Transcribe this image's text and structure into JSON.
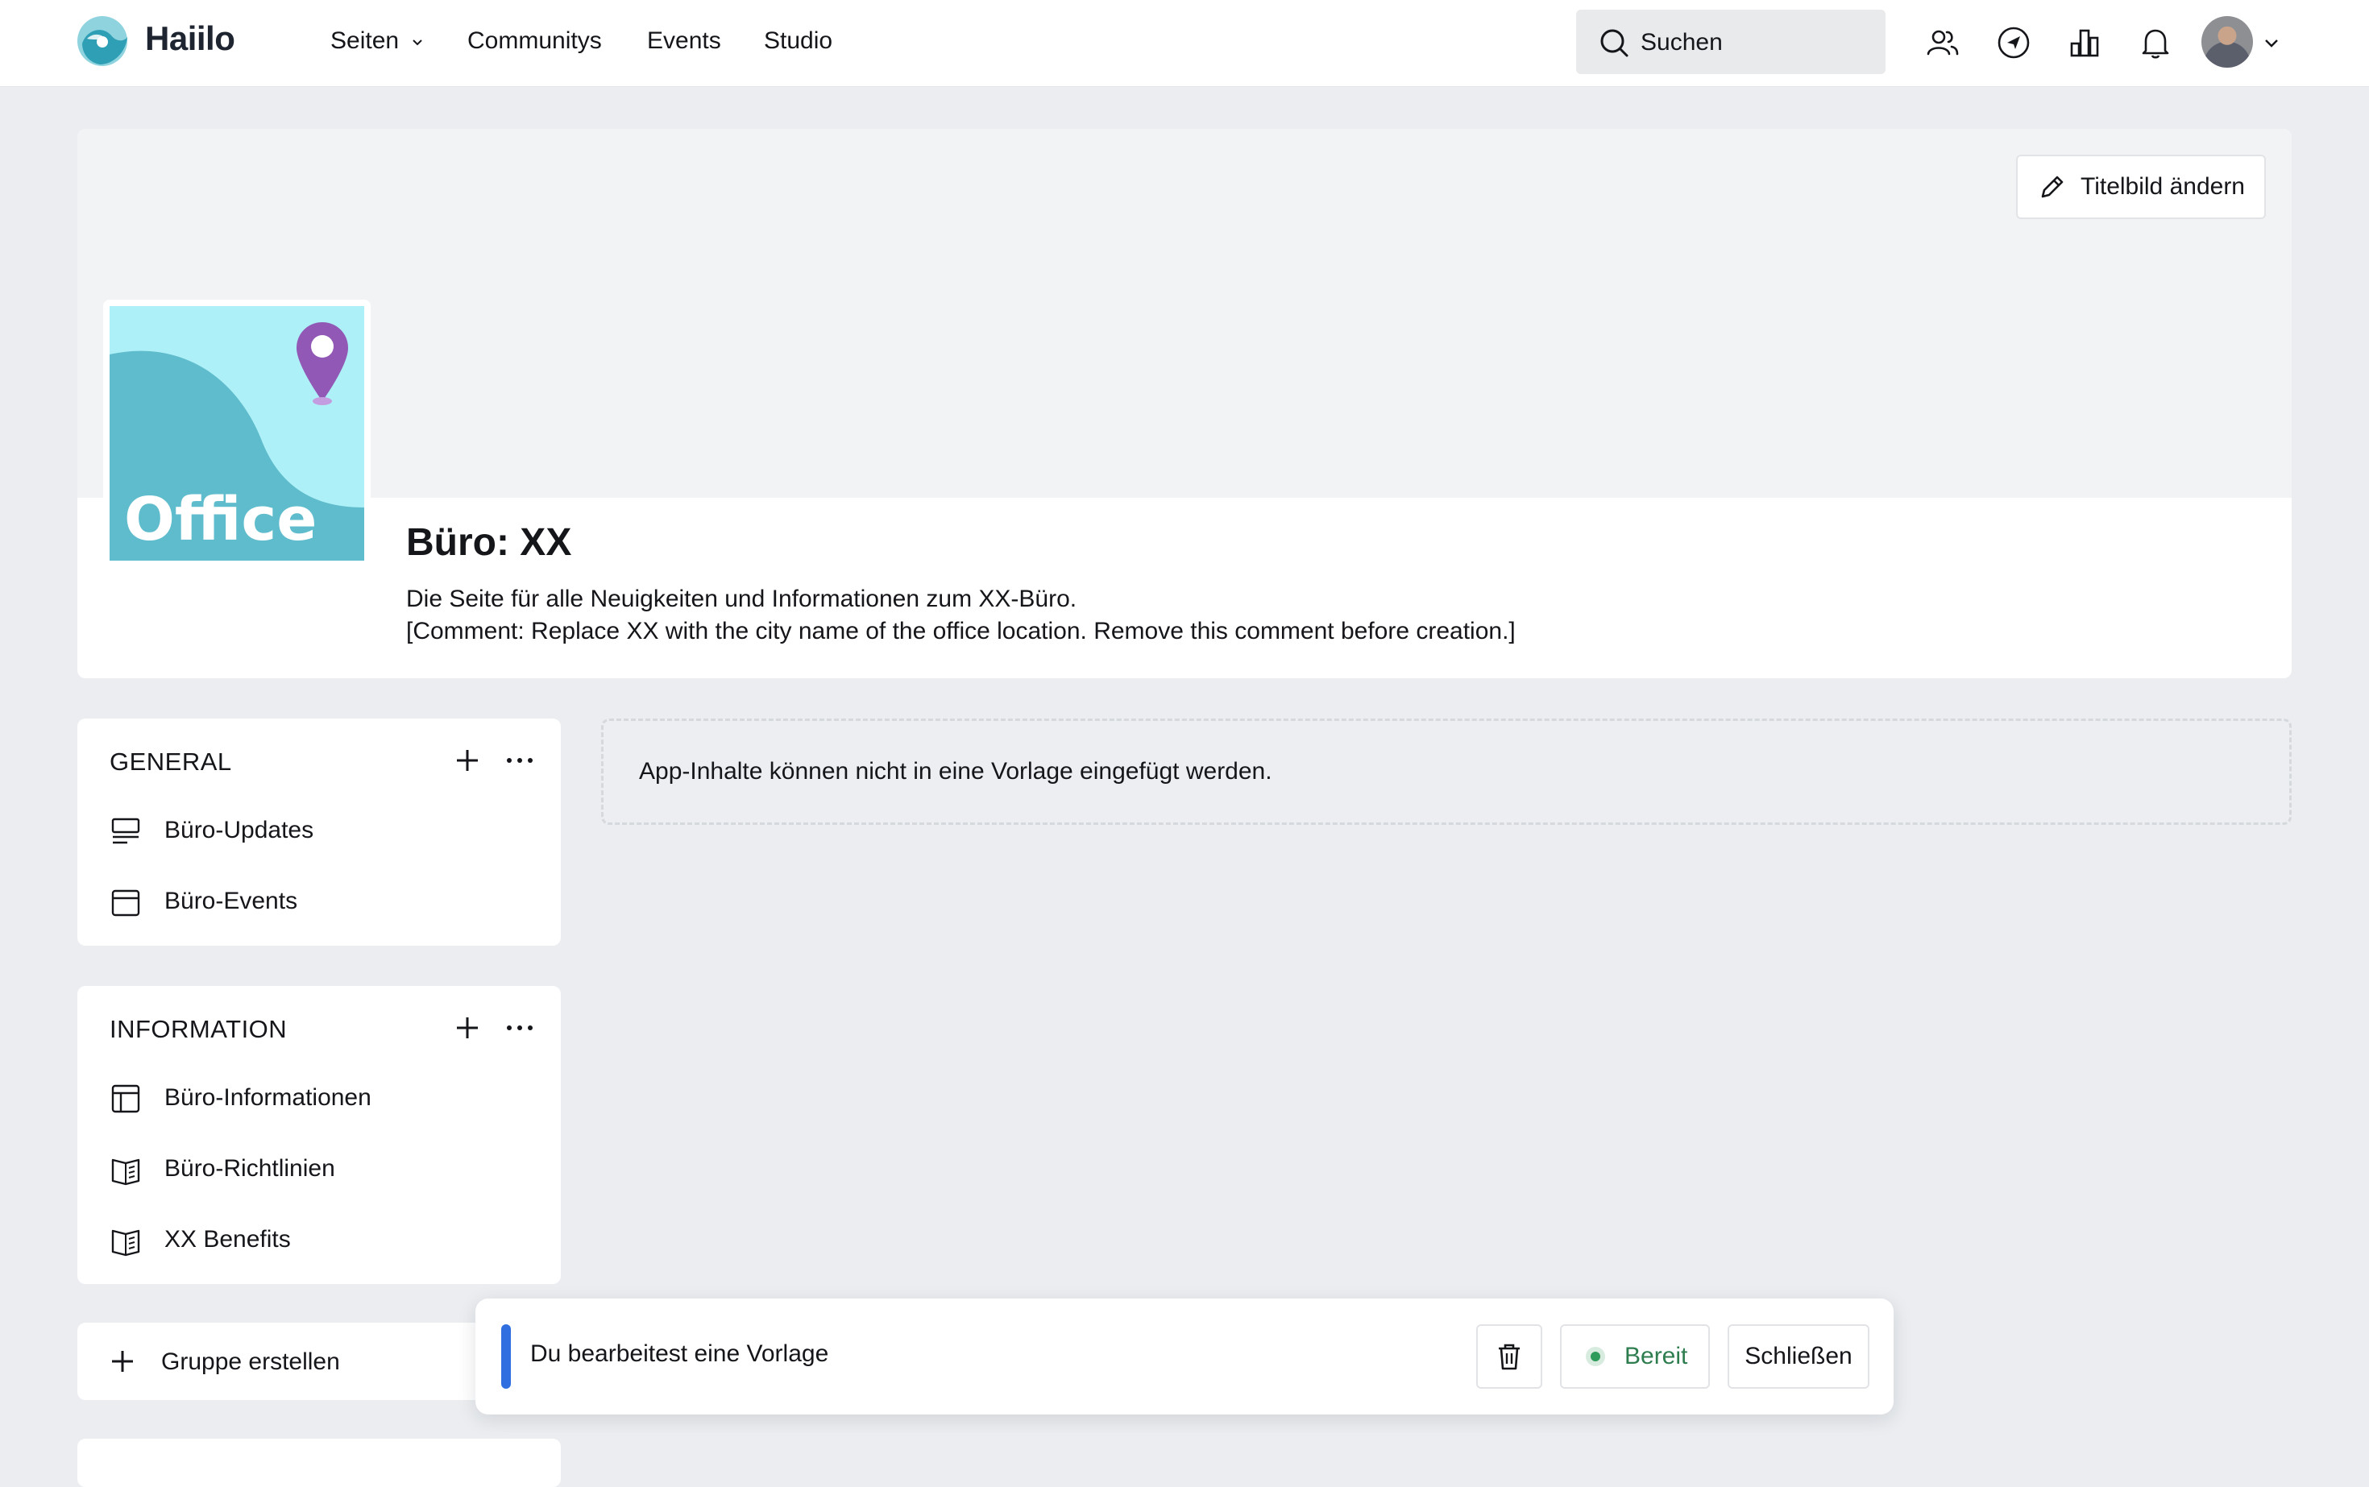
{
  "brand": {
    "name": "Haiilo"
  },
  "nav": {
    "items": [
      {
        "label": "Seiten",
        "has_dropdown": true
      },
      {
        "label": "Communitys"
      },
      {
        "label": "Events"
      },
      {
        "label": "Studio"
      }
    ],
    "search_label": "Suchen",
    "icons": [
      "people-icon",
      "compass-icon",
      "chart-icon",
      "bell-icon"
    ]
  },
  "header": {
    "cover_button_label": "Titelbild ändern",
    "logo_text": "Office",
    "title": "Büro: XX",
    "description_line1": "Die Seite für alle Neuigkeiten und Informationen zum XX-Büro.",
    "description_line2": "[Comment: Replace XX with the city name of the office location. Remove this comment before creation.]"
  },
  "groups": [
    {
      "title": "GENERAL",
      "items": [
        {
          "label": "Büro-Updates",
          "icon": "news-icon"
        },
        {
          "label": "Büro-Events",
          "icon": "calendar-icon"
        }
      ]
    },
    {
      "title": "INFORMATION",
      "items": [
        {
          "label": "Büro-Informationen",
          "icon": "layout-icon"
        },
        {
          "label": "Büro-Richtlinien",
          "icon": "book-icon"
        },
        {
          "label": "XX Benefits",
          "icon": "book-icon"
        }
      ]
    }
  ],
  "create_group_label": "Gruppe erstellen",
  "main": {
    "notice": "App-Inhalte können nicht in eine Vorlage eingefügt werden."
  },
  "template_bar": {
    "text": "Du bearbeitest eine Vorlage",
    "ready_label": "Bereit",
    "close_label": "Schließen"
  },
  "colors": {
    "accent": "#2f6fe0",
    "ready_green": "#2e7d4f",
    "logo_bg_light": "#aef0f7",
    "logo_bg_dark": "#5fbccc",
    "pin_purple": "#9159b5"
  }
}
